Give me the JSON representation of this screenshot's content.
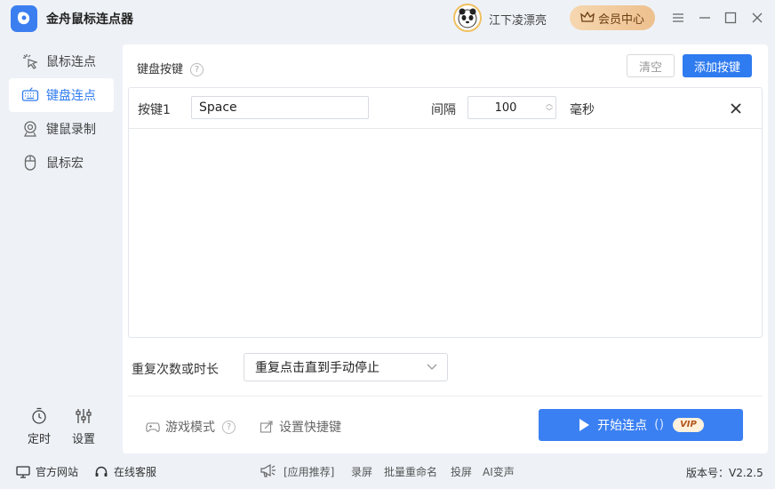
{
  "app": {
    "title": "金舟鼠标连点器",
    "username": "江下凌漂亮",
    "vip_center": "会员中心"
  },
  "sidebar": {
    "items": [
      {
        "label": "鼠标连点",
        "icon": "mouse-click-icon"
      },
      {
        "label": "键盘连点",
        "icon": "keyboard-icon"
      },
      {
        "label": "键鼠录制",
        "icon": "webcam-record-icon"
      },
      {
        "label": "鼠标宏",
        "icon": "mouse-icon"
      }
    ],
    "active_index": 1,
    "bottom": [
      {
        "label": "定时",
        "icon": "timer-icon"
      },
      {
        "label": "设置",
        "icon": "sliders-icon"
      }
    ]
  },
  "main": {
    "section_title": "键盘按键",
    "clear_label": "清空",
    "add_label": "添加按键",
    "keys": [
      {
        "label": "按键1",
        "key": "Space",
        "interval_label": "间隔",
        "interval": "100",
        "unit": "毫秒"
      }
    ],
    "repeat_label": "重复次数或时长",
    "repeat_value": "重复点击直到手动停止",
    "game_mode": "游戏模式",
    "shortcut": "设置快捷键",
    "start_label": "开始连点",
    "start_paren": "()",
    "vip_badge": "VIP"
  },
  "footer": {
    "website": "官方网站",
    "support": "在线客服",
    "recommend": "[应用推荐]",
    "links": [
      "录屏",
      "批量重命名",
      "投屏",
      "AI变声"
    ],
    "version": "版本号：V2.2.5"
  },
  "colors": {
    "accent": "#2f7bf0",
    "vip": "#eec08e",
    "background": "#eef2f7"
  }
}
